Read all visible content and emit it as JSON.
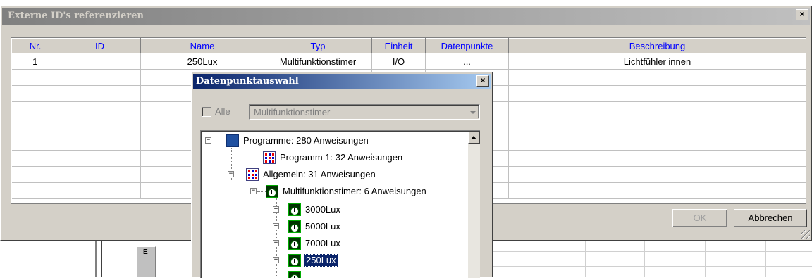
{
  "main_dialog": {
    "title": "Externe ID's referenzieren",
    "close_label": "×",
    "columns": [
      "Nr.",
      "ID",
      "Name",
      "Typ",
      "Einheit",
      "Datenpunkte",
      "Beschreibung"
    ],
    "rows": [
      [
        "1",
        "",
        "250Lux",
        "Multifunktionstimer",
        "I/O",
        "...",
        "Lichtfühler innen"
      ]
    ],
    "ok_label": "OK",
    "cancel_label": "Abbrechen"
  },
  "popup": {
    "title": "Datenpunktauswahl",
    "close_label": "×",
    "alle_label": "Alle",
    "type_select_value": "Multifunktionstimer",
    "tree": [
      {
        "label": "Programme: 280 Anweisungen",
        "toggle": "−"
      },
      {
        "label": "Programm 1: 32 Anweisungen",
        "toggle": ""
      },
      {
        "label": "Allgemein: 31 Anweisungen",
        "toggle": "−"
      },
      {
        "label": "Multifunktionstimer: 6 Anweisungen",
        "toggle": "−"
      },
      {
        "label": "3000Lux",
        "toggle": "+"
      },
      {
        "label": "5000Lux",
        "toggle": "+"
      },
      {
        "label": "7000Lux",
        "toggle": "+"
      },
      {
        "label": "250Lux",
        "toggle": "+",
        "selected": true
      }
    ]
  },
  "background": {
    "tab_label": "E"
  }
}
